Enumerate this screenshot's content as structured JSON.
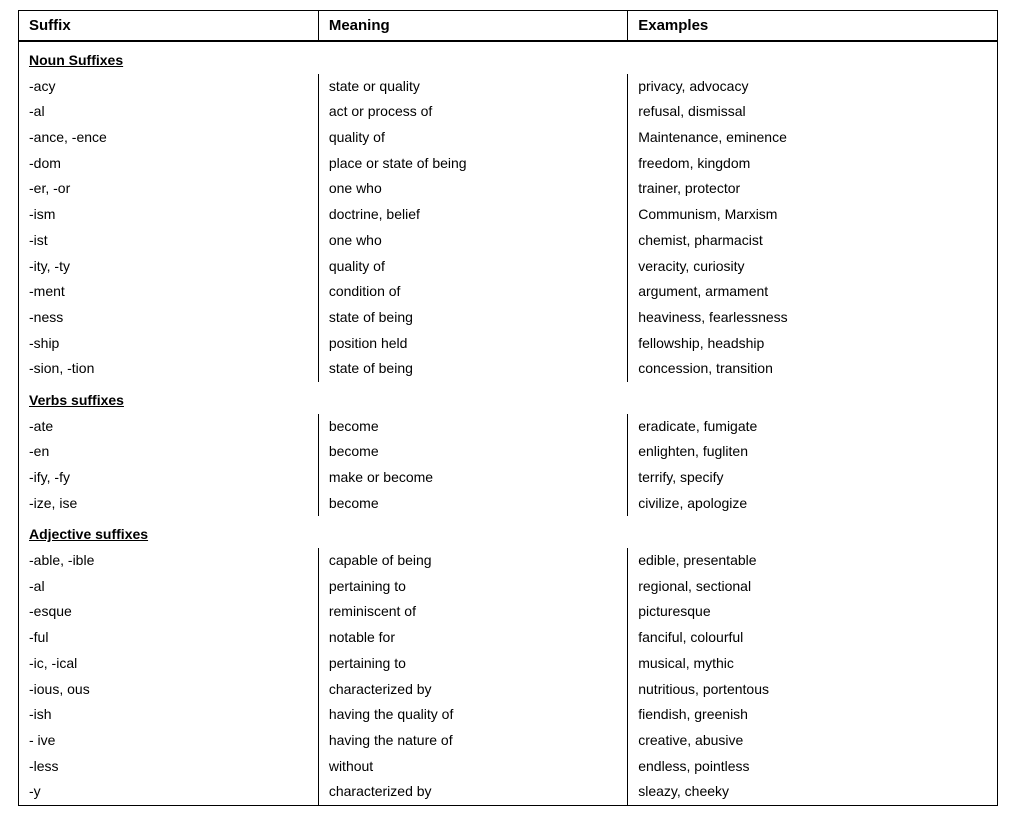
{
  "table": {
    "headers": {
      "suffix": "Suffix",
      "meaning": "Meaning",
      "examples": "Examples"
    },
    "sections": [
      {
        "type": "section-header",
        "label": "Noun Suffixes",
        "suffix": "",
        "meaning": "",
        "examples": ""
      },
      {
        "suffix": "-acy",
        "meaning": "state or quality",
        "examples": "privacy, advocacy"
      },
      {
        "suffix": "-al",
        "meaning": "act or process of",
        "examples": "refusal, dismissal"
      },
      {
        "suffix": "-ance, -ence",
        "meaning": "quality of",
        "examples": "Maintenance, eminence"
      },
      {
        "suffix": "-dom",
        "meaning": "place or state of being",
        "examples": "freedom, kingdom"
      },
      {
        "suffix": "-er, -or",
        "meaning": "one who",
        "examples": "trainer, protector"
      },
      {
        "suffix": "-ism",
        "meaning": "doctrine, belief",
        "examples": "Communism, Marxism"
      },
      {
        "suffix": "-ist",
        "meaning": "one who",
        "examples": "chemist, pharmacist"
      },
      {
        "suffix": "-ity, -ty",
        "meaning": "quality of",
        "examples": "veracity, curiosity"
      },
      {
        "suffix": "-ment",
        "meaning": "condition of",
        "examples": "argument, armament"
      },
      {
        "suffix": "-ness",
        "meaning": "state of being",
        "examples": "heaviness, fearlessness"
      },
      {
        "suffix": "-ship",
        "meaning": "position held",
        "examples": "fellowship, headship"
      },
      {
        "suffix": "-sion, -tion",
        "meaning": "state of being",
        "examples": "concession, transition"
      },
      {
        "type": "section-header",
        "label": "Verbs suffixes",
        "suffix": "",
        "meaning": "",
        "examples": ""
      },
      {
        "suffix": "-ate",
        "meaning": "become",
        "examples": "eradicate, fumigate"
      },
      {
        "suffix": "-en",
        "meaning": "become",
        "examples": "enlighten, fugliten"
      },
      {
        "suffix": "-ify, -fy",
        "meaning": "make or become",
        "examples": "terrify, specify"
      },
      {
        "suffix": "-ize, ise",
        "meaning": "become",
        "examples": "civilize, apologize"
      },
      {
        "type": "section-header",
        "label": "Adjective suffixes",
        "suffix": "",
        "meaning": "",
        "examples": ""
      },
      {
        "suffix": "-able, -ible",
        "meaning": "capable of being",
        "examples": "edible, presentable"
      },
      {
        "suffix": "-al",
        "meaning": "pertaining to",
        "examples": "regional, sectional"
      },
      {
        "suffix": "-esque",
        "meaning": "reminiscent of",
        "examples": "picturesque"
      },
      {
        "suffix": "-ful",
        "meaning": "notable for",
        "examples": "fanciful, colourful"
      },
      {
        "suffix": "-ic, -ical",
        "meaning": "pertaining to",
        "examples": "musical, mythic"
      },
      {
        "suffix": "-ious, ous",
        "meaning": "characterized by",
        "examples": "nutritious, portentous"
      },
      {
        "suffix": "-ish",
        "meaning": "having the quality of",
        "examples": "fiendish, greenish"
      },
      {
        "suffix": "- ive",
        "meaning": "having the nature of",
        "examples": "creative, abusive"
      },
      {
        "suffix": "-less",
        "meaning": "without",
        "examples": "endless, pointless"
      },
      {
        "suffix": "-y",
        "meaning": "characterized by",
        "examples": "sleazy, cheeky"
      }
    ]
  }
}
